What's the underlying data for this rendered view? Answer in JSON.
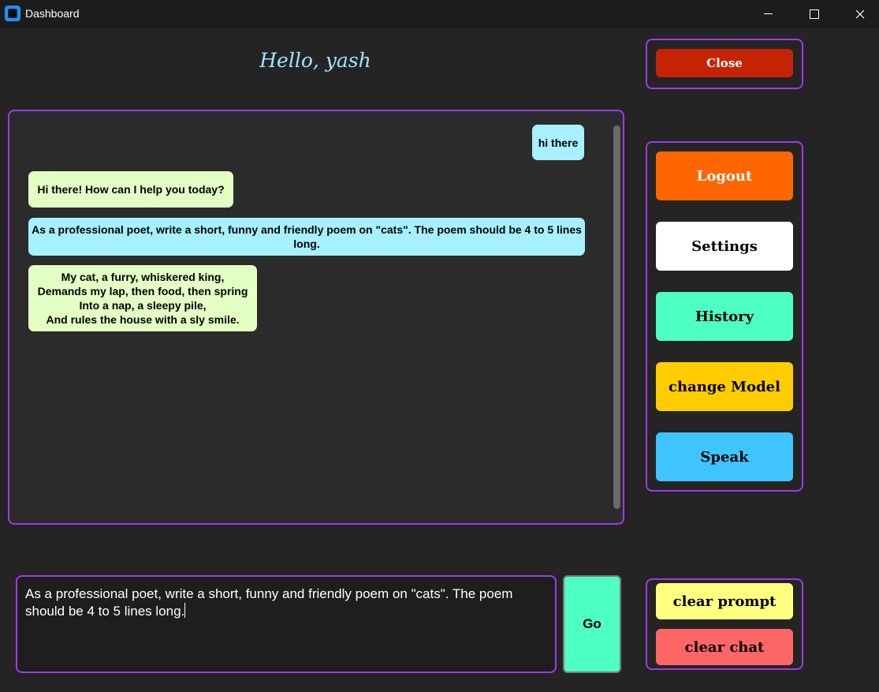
{
  "window": {
    "title": "Dashboard"
  },
  "greeting": "Hello, yash",
  "chat": {
    "messages": [
      {
        "role": "user",
        "text": "hi there"
      },
      {
        "role": "bot",
        "text": "Hi there! How can I help you today?"
      },
      {
        "role": "user",
        "text": "As a professional poet, write a short, funny and friendly poem on \"cats\". The poem should be 4 to 5 lines long."
      },
      {
        "role": "bot",
        "text": "My cat, a furry, whiskered king,\nDemands my lap, then food, then spring\nInto a nap, a sleepy pile,\nAnd rules the house with a sly smile."
      }
    ]
  },
  "buttons": {
    "close": "Close",
    "logout": "Logout",
    "settings": "Settings",
    "history": "History",
    "change_model": "change Model",
    "speak": "Speak",
    "go": "Go",
    "clear_prompt": "clear prompt",
    "clear_chat": "clear chat"
  },
  "prompt": {
    "value": "As a professional poet, write a short, funny and friendly poem on \"cats\". The poem should be 4 to 5 lines long."
  },
  "colors": {
    "accent_border": "#a139e6",
    "user_bubble": "#a6f0ff",
    "bot_bubble": "#e3ffc4",
    "close": "#c62306",
    "logout": "#ff6600",
    "settings": "#ffffff",
    "history": "#4dffc3",
    "change_model": "#ffcc00",
    "speak": "#40c4ff",
    "clear_prompt": "#ffff80",
    "clear_chat": "#ff6666"
  }
}
